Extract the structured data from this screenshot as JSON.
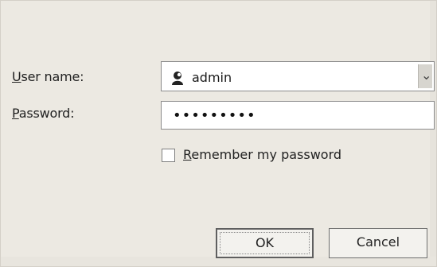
{
  "dialog": {
    "username": {
      "label_first": "U",
      "label_rest": "ser name:",
      "value": "admin",
      "icon": "user-icon"
    },
    "password": {
      "label_first": "P",
      "label_rest": "assword:",
      "masked_value": "•••••••••"
    },
    "remember": {
      "label_first": "R",
      "label_rest": "emember my password",
      "checked": false
    },
    "buttons": {
      "ok": "OK",
      "cancel": "Cancel"
    }
  },
  "colors": {
    "dialog_bg": "#ece9e2",
    "field_border": "#8c8c8c"
  }
}
